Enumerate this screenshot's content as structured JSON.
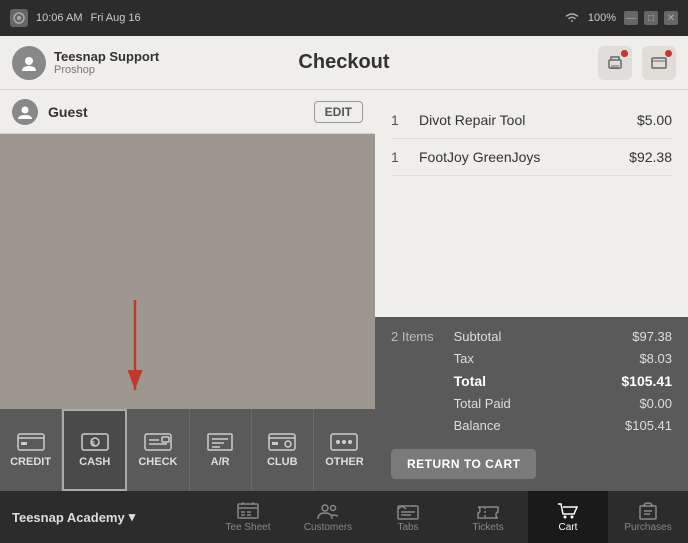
{
  "titlebar": {
    "time": "10:06 AM",
    "date": "Fri Aug 16",
    "battery": "100%",
    "wifi": "WiFi"
  },
  "topbar": {
    "profile_name": "Teesnap Support",
    "profile_sub": "Proshop",
    "title": "Checkout"
  },
  "guest": {
    "name": "Guest",
    "edit_label": "EDIT"
  },
  "payment_methods": [
    {
      "id": "credit",
      "label": "CREDIT"
    },
    {
      "id": "cash",
      "label": "CASH",
      "active": true
    },
    {
      "id": "check",
      "label": "CHECK"
    },
    {
      "id": "ar",
      "label": "A/R"
    },
    {
      "id": "club",
      "label": "CLUB"
    },
    {
      "id": "other",
      "label": "OTHER"
    }
  ],
  "cart": {
    "items": [
      {
        "qty": "1",
        "name": "Divot Repair Tool",
        "price": "$5.00"
      },
      {
        "qty": "1",
        "name": "FootJoy GreenJoys",
        "price": "$92.38"
      }
    ],
    "item_count": "2 Items",
    "subtotal_label": "Subtotal",
    "subtotal_value": "$97.38",
    "tax_label": "Tax",
    "tax_value": "$8.03",
    "total_label": "Total",
    "total_value": "$105.41",
    "total_paid_label": "Total Paid",
    "total_paid_value": "$0.00",
    "balance_label": "Balance",
    "balance_value": "$105.41",
    "return_btn": "RETURN TO CART"
  },
  "bottom_nav": {
    "brand": "Teesnap Academy",
    "items": [
      {
        "id": "tee-sheet",
        "label": "Tee Sheet"
      },
      {
        "id": "customers",
        "label": "Customers"
      },
      {
        "id": "tabs",
        "label": "Tabs"
      },
      {
        "id": "tickets",
        "label": "Tickets"
      },
      {
        "id": "cart",
        "label": "Cart",
        "active": true
      },
      {
        "id": "purchases",
        "label": "Purchases"
      }
    ]
  }
}
